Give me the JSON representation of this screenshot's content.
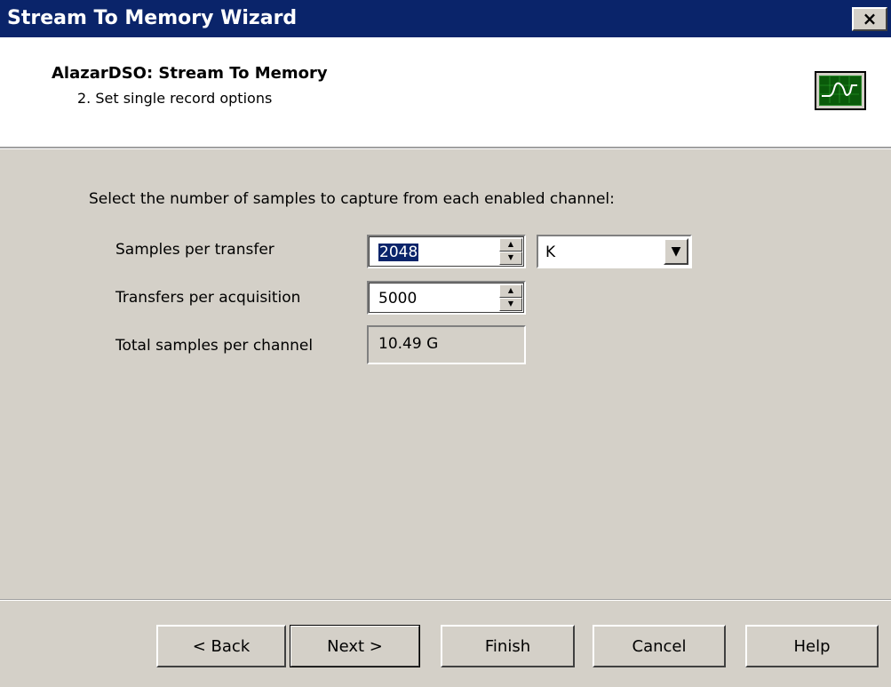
{
  "window": {
    "title": "Stream To Memory Wizard",
    "close_label": "×"
  },
  "header": {
    "title": "AlazarDSO: Stream To Memory",
    "subtitle": "2. Set single record options",
    "icon": "oscilloscope-icon"
  },
  "content": {
    "prompt": "Select the number of samples to capture from each enabled channel:",
    "samples_per_transfer": {
      "label": "Samples per transfer",
      "value": "2048",
      "unit": "K"
    },
    "transfers_per_acquisition": {
      "label": "Transfers per acquisition",
      "value": "5000"
    },
    "total_samples": {
      "label": "Total samples per channel",
      "value": "10.49 G"
    }
  },
  "buttons": {
    "back": "< Back",
    "next": "Next >",
    "finish": "Finish",
    "cancel": "Cancel",
    "help": "Help"
  },
  "colors": {
    "titlebar": "#0a246a",
    "face": "#d4d0c8",
    "header_bg": "#ffffff"
  }
}
